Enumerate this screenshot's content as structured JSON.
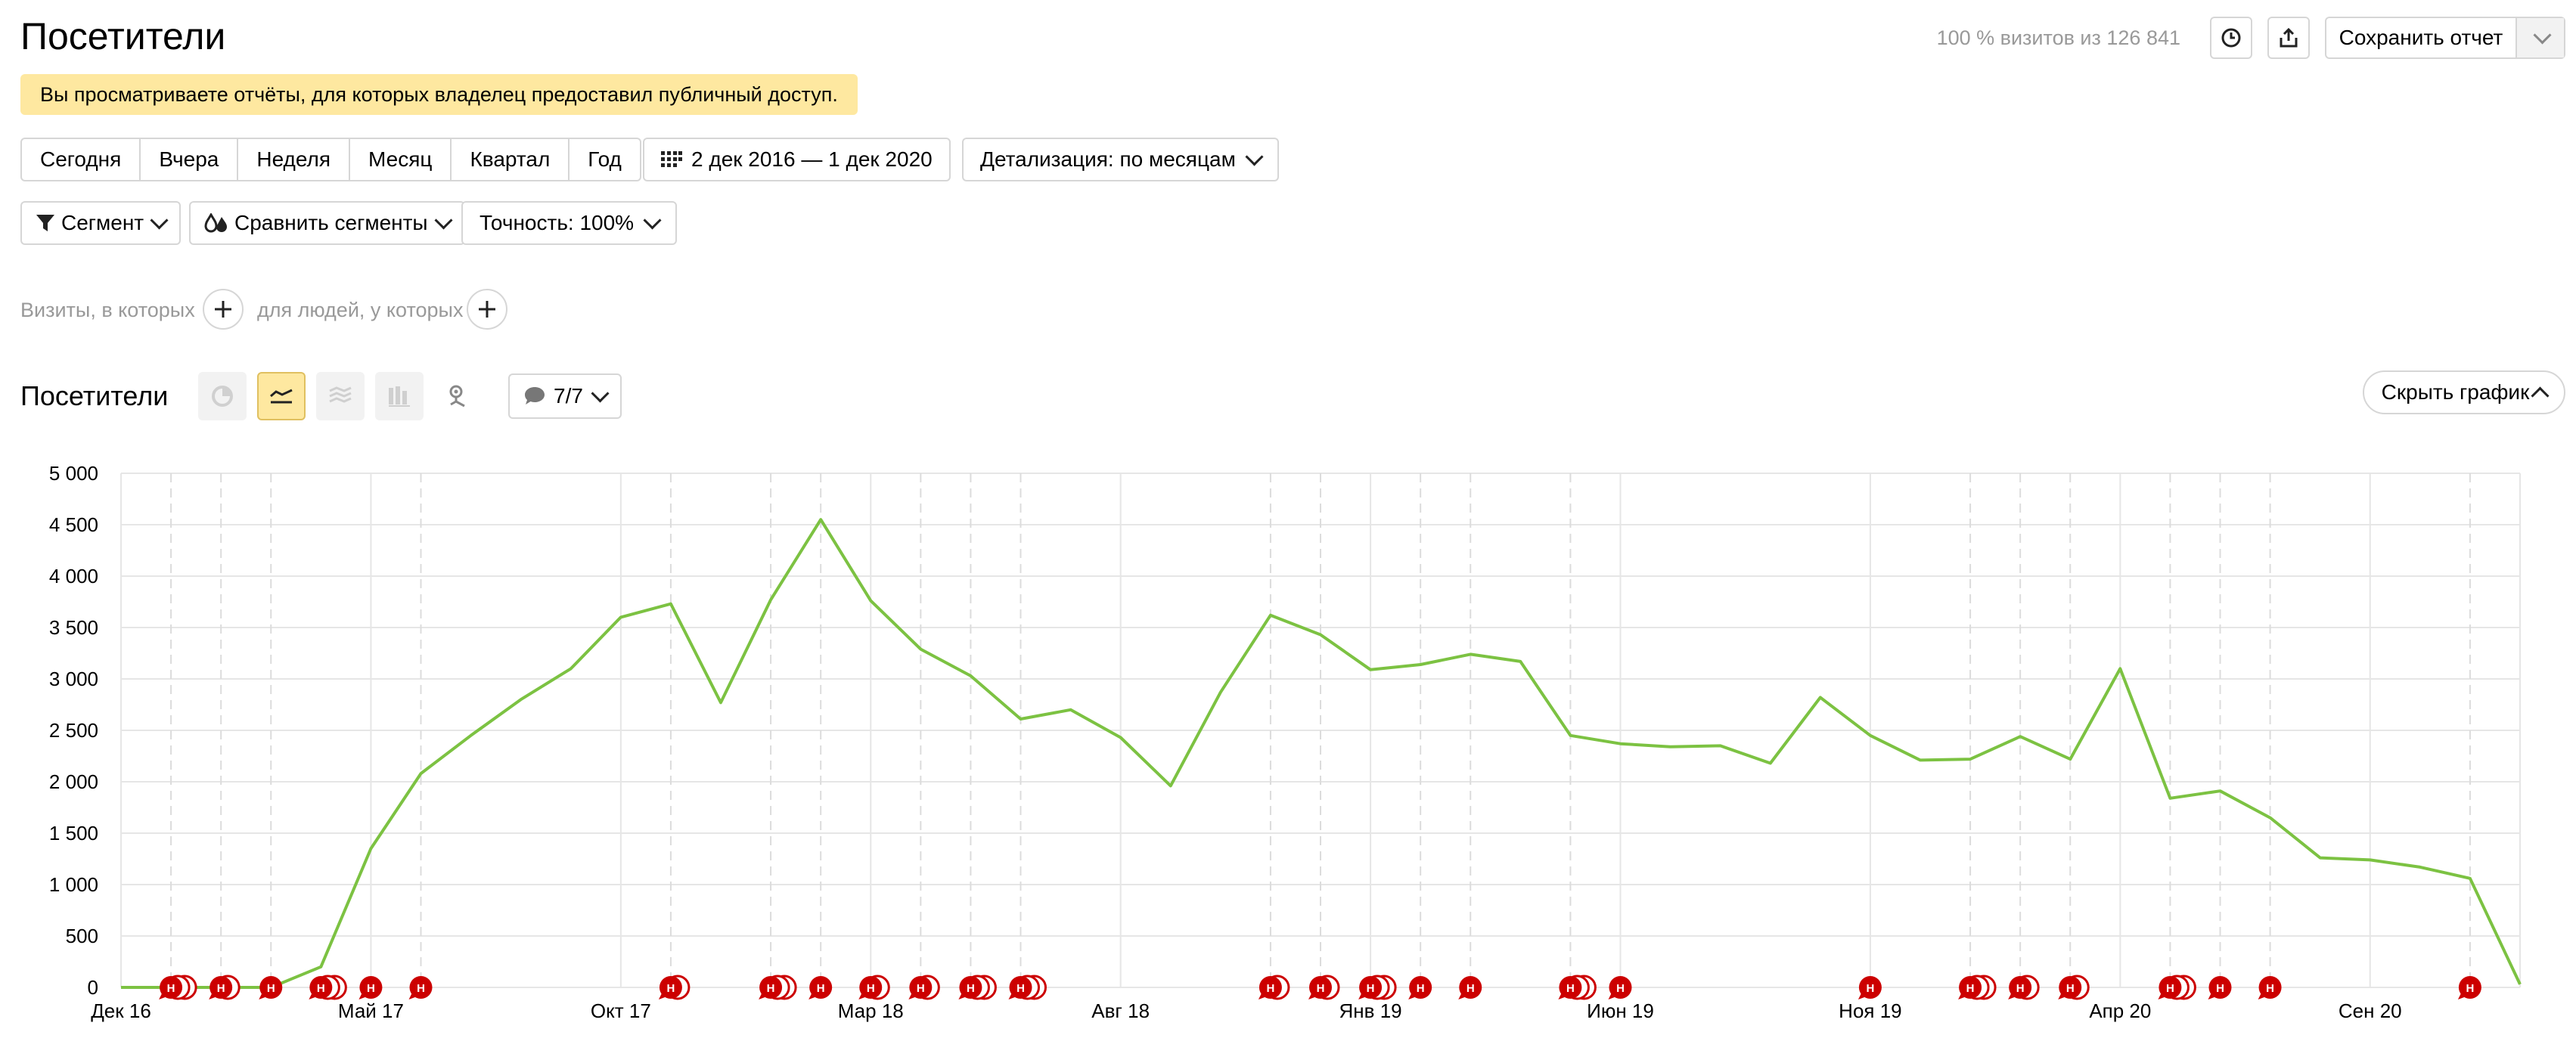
{
  "page": {
    "title": "Посетители",
    "visits_info": "100 % визитов из 126 841",
    "save_report": "Сохранить отчет",
    "notice": "Вы просматриваете отчёты, для которых владелец предоставил публичный доступ."
  },
  "periods": [
    "Сегодня",
    "Вчера",
    "Неделя",
    "Месяц",
    "Квартал",
    "Год"
  ],
  "date_range": "2 дек 2016 — 1 дек 2020",
  "detail": "Детализация: по месяцам",
  "segment": "Сегмент",
  "compare": "Сравнить сегменты",
  "accuracy": "Точность: 100%",
  "conditions": {
    "visits": "Визиты, в которых",
    "people": "для людей, у которых"
  },
  "report": {
    "title": "Посетители",
    "notes": "7/7",
    "hide_chart": "Скрыть график"
  },
  "colors": {
    "line": "#7cc242",
    "note": "#cc0000",
    "notice_bg": "#fee8a0"
  },
  "icons": [
    "clock-icon",
    "export-icon",
    "chevron-down-icon",
    "calendar-icon",
    "filter-icon",
    "compare-icon",
    "pie-chart-icon",
    "line-chart-icon",
    "area-chart-icon",
    "bar-chart-icon",
    "map-pin-icon",
    "comment-icon",
    "plus-icon",
    "chevron-up-icon"
  ],
  "chart_data": {
    "type": "line",
    "ylim": [
      0,
      5000
    ],
    "yticks": [
      "5 000",
      "4 500",
      "4 000",
      "3 500",
      "3 000",
      "2 500",
      "2 000",
      "1 500",
      "1 000",
      "500",
      "0"
    ],
    "xtick_labels": [
      {
        "label": "Дек 16",
        "index": 0
      },
      {
        "label": "Май 17",
        "index": 5
      },
      {
        "label": "Окт 17",
        "index": 10
      },
      {
        "label": "Мар 18",
        "index": 15
      },
      {
        "label": "Авг 18",
        "index": 20
      },
      {
        "label": "Янв 19",
        "index": 25
      },
      {
        "label": "Июн 19",
        "index": 30
      },
      {
        "label": "Ноя 19",
        "index": 35
      },
      {
        "label": "Апр 20",
        "index": 40
      },
      {
        "label": "Сен 20",
        "index": 45
      }
    ],
    "series": [
      {
        "values": [
          0,
          0,
          0,
          0,
          200,
          1350,
          2080,
          2450,
          2800,
          3100,
          3600,
          3730,
          2770,
          3770,
          4550,
          3760,
          3290,
          3030,
          2610,
          2700,
          2430,
          1960,
          2870,
          3620,
          3430,
          3090,
          3140,
          3240,
          3170,
          2450,
          2370,
          2340,
          2350,
          2180,
          2820,
          2450,
          2210,
          2220,
          2440,
          2220,
          3100,
          1840,
          1910,
          1650,
          1260,
          1240,
          1170,
          1060,
          30
        ]
      }
    ],
    "annotations": {
      "label": "Н",
      "positions": [
        1,
        2,
        3,
        4,
        5,
        6,
        11,
        13,
        14,
        15,
        16,
        17,
        18,
        23,
        24,
        25,
        26,
        27,
        29,
        30,
        35,
        37,
        38,
        39,
        41,
        42,
        43,
        47
      ],
      "counts": [
        3,
        2,
        1,
        3,
        1,
        1,
        2,
        3,
        1,
        2,
        2,
        3,
        3,
        2,
        2,
        3,
        1,
        1,
        3,
        1,
        1,
        3,
        2,
        2,
        3,
        1,
        1,
        1
      ]
    },
    "dashed_verticals": [
      1,
      2,
      3,
      6,
      11,
      13,
      14,
      16,
      17,
      18,
      23,
      24,
      26,
      27,
      29,
      37,
      38,
      39,
      41,
      42,
      43,
      47
    ],
    "grid": true
  }
}
